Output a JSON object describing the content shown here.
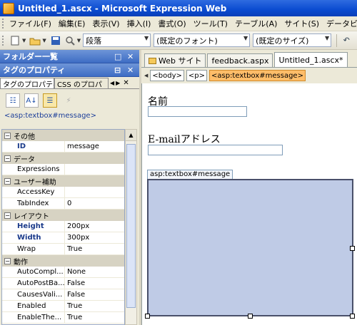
{
  "window": {
    "title": "Untitled_1.ascx - Microsoft Expression Web"
  },
  "menu": [
    "ファイル(F)",
    "編集(E)",
    "表示(V)",
    "挿入(I)",
    "書式(O)",
    "ツール(T)",
    "テーブル(A)",
    "サイト(S)",
    "データビ"
  ],
  "toolbar": {
    "paragraph_style": "段落",
    "font_family": "(既定のフォント)",
    "font_size": "(既定のサイズ)"
  },
  "folder_panel": {
    "title": "フォルダー一覧"
  },
  "tag_props_panel": {
    "title": "タグのプロパティ",
    "tabs": [
      "タグのプロパティ",
      "CSS のプロパ"
    ],
    "tag_label": "<asp:textbox#message>"
  },
  "property_grid": {
    "categories": [
      {
        "label": "その他",
        "rows": [
          {
            "name": "ID",
            "value": "message"
          }
        ]
      },
      {
        "label": "データ",
        "rows": [
          {
            "name": "Expressions",
            "value": ""
          }
        ]
      },
      {
        "label": "ユーザー補助",
        "rows": [
          {
            "name": "AccessKey",
            "value": ""
          },
          {
            "name": "TabIndex",
            "value": "0"
          }
        ]
      },
      {
        "label": "レイアウト",
        "rows": [
          {
            "name": "Height",
            "value": "200px"
          },
          {
            "name": "Width",
            "value": "300px"
          },
          {
            "name": "Wrap",
            "value": "True"
          }
        ]
      },
      {
        "label": "動作",
        "rows": [
          {
            "name": "AutoCompl...",
            "value": "None"
          },
          {
            "name": "AutoPostBa...",
            "value": "False"
          },
          {
            "name": "CausesVali...",
            "value": "False"
          },
          {
            "name": "Enabled",
            "value": "True"
          },
          {
            "name": "EnableThe...",
            "value": "True"
          }
        ]
      }
    ]
  },
  "doc_tabs": [
    "Web サイト",
    "feedback.aspx",
    "Untitled_1.ascx*"
  ],
  "breadcrumb": [
    "<body>",
    "<p>",
    "<asp:textbox#message>"
  ],
  "form": {
    "name_label": "名前",
    "email_label": "E-mailアドレス",
    "textbox_tag": "asp:textbox#message"
  },
  "colors": {
    "accent": "#0a4bd0",
    "selection": "#ffbd69",
    "textbox_fill": "#bfcbe6"
  }
}
